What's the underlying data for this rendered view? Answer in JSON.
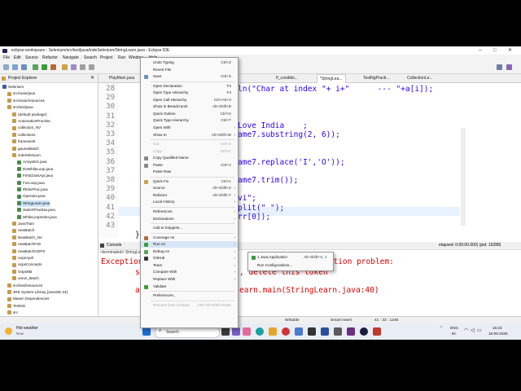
{
  "window": {
    "title": "eclipse-workspace - Selenium/src/test/java/indeSelenium/StringLearn.java - Eclipse IDE"
  },
  "menubar": [
    "File",
    "Edit",
    "Source",
    "Refactor",
    "Navigate",
    "Search",
    "Project",
    "Run",
    "Window",
    "Help"
  ],
  "project_explorer": {
    "title": "Project Explorer",
    "items": [
      {
        "label": "Selenium",
        "depth": 0
      },
      {
        "label": "src/main/java",
        "depth": 1
      },
      {
        "label": "src/main/resources",
        "depth": 1
      },
      {
        "label": "src/test/java",
        "depth": 1
      },
      {
        "label": "(default package)",
        "depth": 2
      },
      {
        "label": "AutomationPractise",
        "depth": 2
      },
      {
        "label": "collection_NV",
        "depth": 2
      },
      {
        "label": "collections",
        "depth": 2
      },
      {
        "label": "framework",
        "depth": 2
      },
      {
        "label": "gauravBatch",
        "depth": 2
      },
      {
        "label": "indeSelenium",
        "depth": 2
      },
      {
        "label": "ArraysEG.java",
        "depth": 3
      },
      {
        "label": "DoWhileLoop.java",
        "depth": 3
      },
      {
        "label": "FirstClassApr.java",
        "depth": 3
      },
      {
        "label": "ForLoop.java",
        "depth": 3
      },
      {
        "label": "IfElsePrac.java",
        "depth": 3
      },
      {
        "label": "Operator.java",
        "depth": 3
      },
      {
        "label": "StringLearn.java",
        "depth": 3,
        "selected": true
      },
      {
        "label": "SwitchPractise.java",
        "depth": 3
      },
      {
        "label": "WhileLoopInder.java",
        "depth": 3
      },
      {
        "label": "JavaTrain",
        "depth": 2
      },
      {
        "label": "newBatch",
        "depth": 2
      },
      {
        "label": "NewBatch_NV",
        "depth": 2
      },
      {
        "label": "newBatchFeb",
        "depth": 2
      },
      {
        "label": "newBatchOOPS",
        "depth": 2
      },
      {
        "label": "oopsApril",
        "depth": 2
      },
      {
        "label": "oopsConcepts",
        "depth": 2
      },
      {
        "label": "OopsNB",
        "depth": 2
      },
      {
        "label": "varun_Batch",
        "depth": 2
      },
      {
        "label": "src/test/resources",
        "depth": 1
      },
      {
        "label": "JRE System Library [JavaSE-24]",
        "depth": 1
      },
      {
        "label": "Maven Dependencies",
        "depth": 1
      },
      {
        "label": "TestNG",
        "depth": 1
      },
      {
        "label": "src",
        "depth": 1
      }
    ]
  },
  "editor_tabs": [
    "PlayMain.java",
    "SeleniumBasics.java",
    "If_conditio...",
    "*StringLea...",
    "TestNgPracti...",
    "CollectionLe..."
  ],
  "line_numbers": [
    "28",
    "29",
    "30",
    "31",
    "32",
    "33",
    "34",
    "35",
    "36",
    "37",
    "38",
    "39",
    "40",
    "41",
    "42",
    "43"
  ],
  "code_lines": [
    {
      "row": 0,
      "text": "ln(\"Char at index \"+ i+\"      --- \"+a[i]);"
    },
    {
      "row": 4,
      "text": "Love India    ;"
    },
    {
      "row": 5,
      "text": "ame7.substring(2, 6));"
    },
    {
      "row": 8,
      "text": "ame7.replace('I','O'));"
    },
    {
      "row": 10,
      "text": "ame7.trim());"
    },
    {
      "row": 12,
      "text": "vi\";"
    },
    {
      "row": 13,
      "text": "plit(\" \");"
    },
    {
      "row": 14,
      "text": "rr[0]);"
    },
    {
      "row": 16,
      "text": "}"
    }
  ],
  "console": {
    "tab": "Console",
    "header": "<terminated> StringLe",
    "elapsed": "elapsed: 0:00:00.000) (pid: 19288)",
    "lines": [
      "Exception",
      "d compilation problem:",
      ", delete this token",
      "earn.main(StringLearn.java:40)"
    ]
  },
  "context_menu": [
    {
      "label": "Undo Typing",
      "shortcut": "Ctrl+Z"
    },
    {
      "label": "Revert File"
    },
    {
      "label": "Save",
      "shortcut": "Ctrl+S"
    },
    {
      "sep": true
    },
    {
      "label": "Open Declaration",
      "shortcut": "F3"
    },
    {
      "label": "Open Type Hierarchy",
      "shortcut": "F4"
    },
    {
      "label": "Open Call Hierarchy",
      "shortcut": "Ctrl+Alt+H"
    },
    {
      "label": "Show in Breadcrumb",
      "shortcut": "Alt+Shift+B"
    },
    {
      "label": "Quick Outline",
      "shortcut": "Ctrl+O"
    },
    {
      "label": "Quick Type Hierarchy",
      "shortcut": "Ctrl+T"
    },
    {
      "label": "Open With",
      "arrow": true
    },
    {
      "label": "Show In",
      "shortcut": "Alt+Shift+W",
      "arrow": true
    },
    {
      "sep": true
    },
    {
      "label": "Cut",
      "shortcut": "Ctrl+X",
      "disabled": true
    },
    {
      "label": "Copy",
      "shortcut": "Ctrl+C",
      "disabled": true
    },
    {
      "label": "Copy Qualified Name"
    },
    {
      "label": "Paste",
      "shortcut": "Ctrl+V"
    },
    {
      "label": "Paste Raw"
    },
    {
      "sep": true
    },
    {
      "label": "Quick Fix",
      "shortcut": "Ctrl+1"
    },
    {
      "label": "Source",
      "shortcut": "Alt+Shift+S",
      "arrow": true
    },
    {
      "label": "Refactor",
      "shortcut": "Alt+Shift+T",
      "arrow": true
    },
    {
      "label": "Local History",
      "arrow": true
    },
    {
      "sep": true
    },
    {
      "label": "References",
      "arrow": true
    },
    {
      "label": "Declarations",
      "arrow": true
    },
    {
      "sep": true
    },
    {
      "label": "Add to Snippets..."
    },
    {
      "sep": true
    },
    {
      "label": "Coverage As",
      "arrow": true
    },
    {
      "label": "Run As",
      "arrow": true,
      "highlight": true
    },
    {
      "label": "Debug As",
      "arrow": true
    },
    {
      "label": "GitHub",
      "arrow": true
    },
    {
      "label": "Team",
      "arrow": true
    },
    {
      "label": "Compare With",
      "arrow": true
    },
    {
      "label": "Replace With",
      "arrow": true
    },
    {
      "label": "Validate"
    },
    {
      "sep": true
    },
    {
      "label": "Preferences..."
    },
    {
      "sep": true
    },
    {
      "label": "Remove from Context",
      "shortcut": "Ctrl+Alt+Shift+Down",
      "disabled": true
    }
  ],
  "submenu": [
    {
      "label": "1 Java Application",
      "shortcut": "Alt+Shift+X, J"
    },
    {
      "label": "Run Configurations..."
    }
  ],
  "statusbar": {
    "writable": "Writable",
    "insert": "Smart Insert",
    "position": "41 : 33 : 1246"
  },
  "taskbar": {
    "weather_title": "Hot weather",
    "weather_sub": "Now",
    "search": "Search",
    "lang": "ENG",
    "region": "IN",
    "time": "16:33",
    "date": "18-05-2026"
  },
  "colors": {
    "accent": "#2a00ff",
    "error": "#d00000",
    "highlight": "#d7e6f6"
  }
}
